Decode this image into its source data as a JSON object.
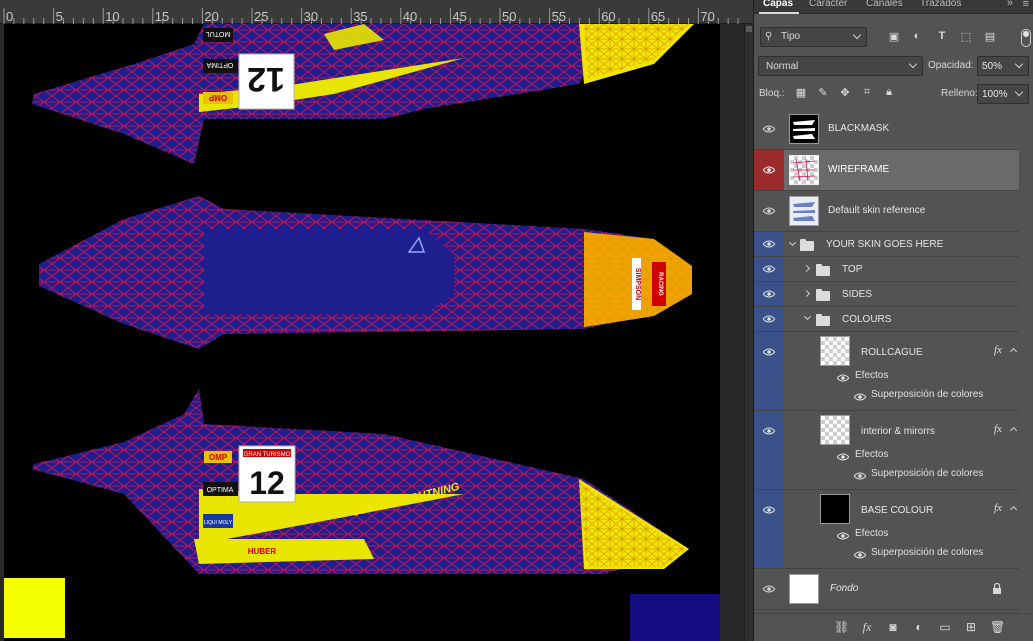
{
  "ruler": {
    "ticks": [
      "0",
      "5",
      "10",
      "15",
      "20",
      "25",
      "30",
      "35",
      "40",
      "45",
      "50",
      "55",
      "60",
      "65",
      "70"
    ]
  },
  "canvas": {
    "decals_top": [
      "MOTUL",
      "OPTIMA",
      "OMP",
      "12"
    ],
    "decals_mid": [
      "SIMPSON",
      "RACING"
    ],
    "decals_bottom": [
      "OMP",
      "GRAN TURISMO",
      "12",
      "OPTIMA",
      "LIQUI MOLY",
      "JOHNNY LIGHTNING",
      "HUBER"
    ],
    "colors": {
      "wire": "#c4134f",
      "body": "#1f1e8f",
      "yellow": "#f2e600",
      "orange": "#f6a200",
      "swatch_yellow": "#f5ff00",
      "swatch_blue": "#140d82"
    }
  },
  "panel": {
    "tabs": [
      "Capas",
      "Carácter",
      "Canales",
      "Trazados"
    ],
    "active_tab": "Capas",
    "collapse_icon": "double-chevron-icon",
    "menu_icon": "hamburger-icon",
    "filter": {
      "kind_label": "Tipo",
      "icons": [
        "image-filter-icon",
        "adjustment-filter-icon",
        "type-filter-icon",
        "shape-filter-icon",
        "smart-object-filter-icon"
      ]
    },
    "blend_mode": "Normal",
    "opacity_label": "Opacidad:",
    "opacity_value": "50%",
    "lock_label": "Bloq.:",
    "lock_icons": [
      "lock-transparent-icon",
      "lock-image-icon",
      "lock-position-icon",
      "lock-artboard-icon",
      "lock-all-icon"
    ],
    "fill_label": "Relleno:",
    "fill_value": "100%",
    "layers": [
      {
        "name": "BLACKMASK",
        "type": "layer"
      },
      {
        "name": "WIREFRAME",
        "type": "layer",
        "selected": true
      },
      {
        "name": "Default skin reference",
        "type": "layer"
      },
      {
        "name": "YOUR SKIN GOES HERE",
        "type": "group",
        "expanded": true
      },
      {
        "name": "TOP",
        "type": "group",
        "expanded": false
      },
      {
        "name": "SIDES",
        "type": "group",
        "expanded": false
      },
      {
        "name": "COLOURS",
        "type": "group",
        "expanded": true
      },
      {
        "name": "ROLLCAGUE",
        "type": "layer",
        "fx": "fx",
        "effects_label": "Efectos",
        "effect": "Superposición de colores"
      },
      {
        "name": "interior & mirorrs",
        "type": "layer",
        "fx": "fx",
        "effects_label": "Efectos",
        "effect": "Superposición de colores"
      },
      {
        "name": "BASE COLOUR",
        "type": "layer",
        "fx": "fx",
        "effects_label": "Efectos",
        "effect": "Superposición de colores"
      },
      {
        "name": "Fondo",
        "type": "background",
        "locked": true
      }
    ],
    "footer_icons": [
      "link-layers-icon",
      "layer-style-icon",
      "layer-mask-icon",
      "adjustment-layer-icon",
      "new-group-icon",
      "new-layer-icon",
      "delete-layer-icon"
    ]
  }
}
